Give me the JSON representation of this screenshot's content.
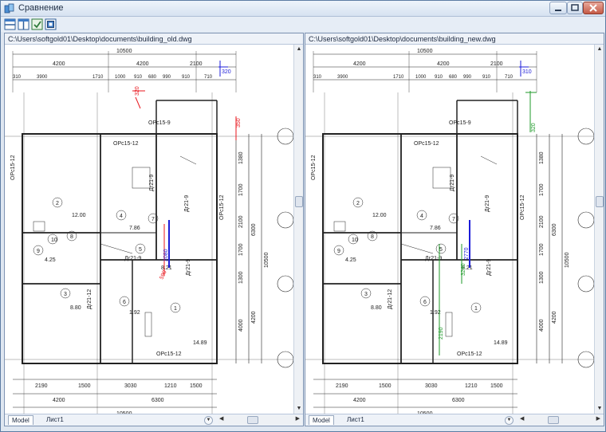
{
  "window": {
    "title": "Сравнение"
  },
  "panes": [
    {
      "id": "left",
      "path": "C:\\Users\\softgold01\\Desktop\\documents\\building_old.dwg",
      "tabs": [
        "Model",
        "Лист1"
      ]
    },
    {
      "id": "right",
      "path": "C:\\Users\\softgold01\\Desktop\\documents\\building_new.dwg",
      "tabs": [
        "Model",
        "Лист1"
      ]
    }
  ],
  "drawing": {
    "top_overall": "10500",
    "top_dims": [
      "4200",
      "4200",
      "2100"
    ],
    "top_sub": [
      "310",
      "3900",
      "1710",
      "1000",
      "910",
      "680",
      "990",
      "910",
      "710"
    ],
    "bottom_dims": [
      "2190",
      "1500",
      "3030",
      "1210",
      "1500"
    ],
    "bottom_mid": [
      "4200",
      "6300"
    ],
    "bottom_overall": "10500",
    "right_dims": [
      "1380",
      "1700",
      "2100",
      "1700",
      "1300",
      "6300",
      "4000",
      "4200",
      "10500"
    ],
    "axes": [
      "1",
      "2",
      "3",
      "4"
    ],
    "rooms": [
      "1",
      "2",
      "3",
      "4",
      "5",
      "6",
      "7",
      "8",
      "9",
      "10"
    ],
    "areas": [
      "12.00",
      "7.86",
      "4.25",
      "8.21",
      "8.80",
      "1.92",
      "14.89"
    ],
    "window_tags": [
      "ОРс15-12",
      "ОРс15-9",
      "ОРс15-12",
      "ОРс15-12",
      "ОРс15-12"
    ],
    "door_tags": [
      "Дг21-9",
      "Дг21-9",
      "Дг21-9",
      "Дг21-12",
      "Дг21-9"
    ],
    "left_changes": {
      "red": [
        "320",
        "350",
        "2080",
        "590"
      ],
      "blue": [
        "320",
        "2080"
      ]
    },
    "right_changes": {
      "green": [
        "320",
        "2190",
        "3240"
      ],
      "blue": [
        "2770",
        "310"
      ]
    },
    "colors": {
      "change_red": "#e8141b",
      "change_blue": "#1c1cd8",
      "change_green": "#1f9a2a",
      "linework": "#222222",
      "window_frame": "#5c7ca3"
    }
  }
}
